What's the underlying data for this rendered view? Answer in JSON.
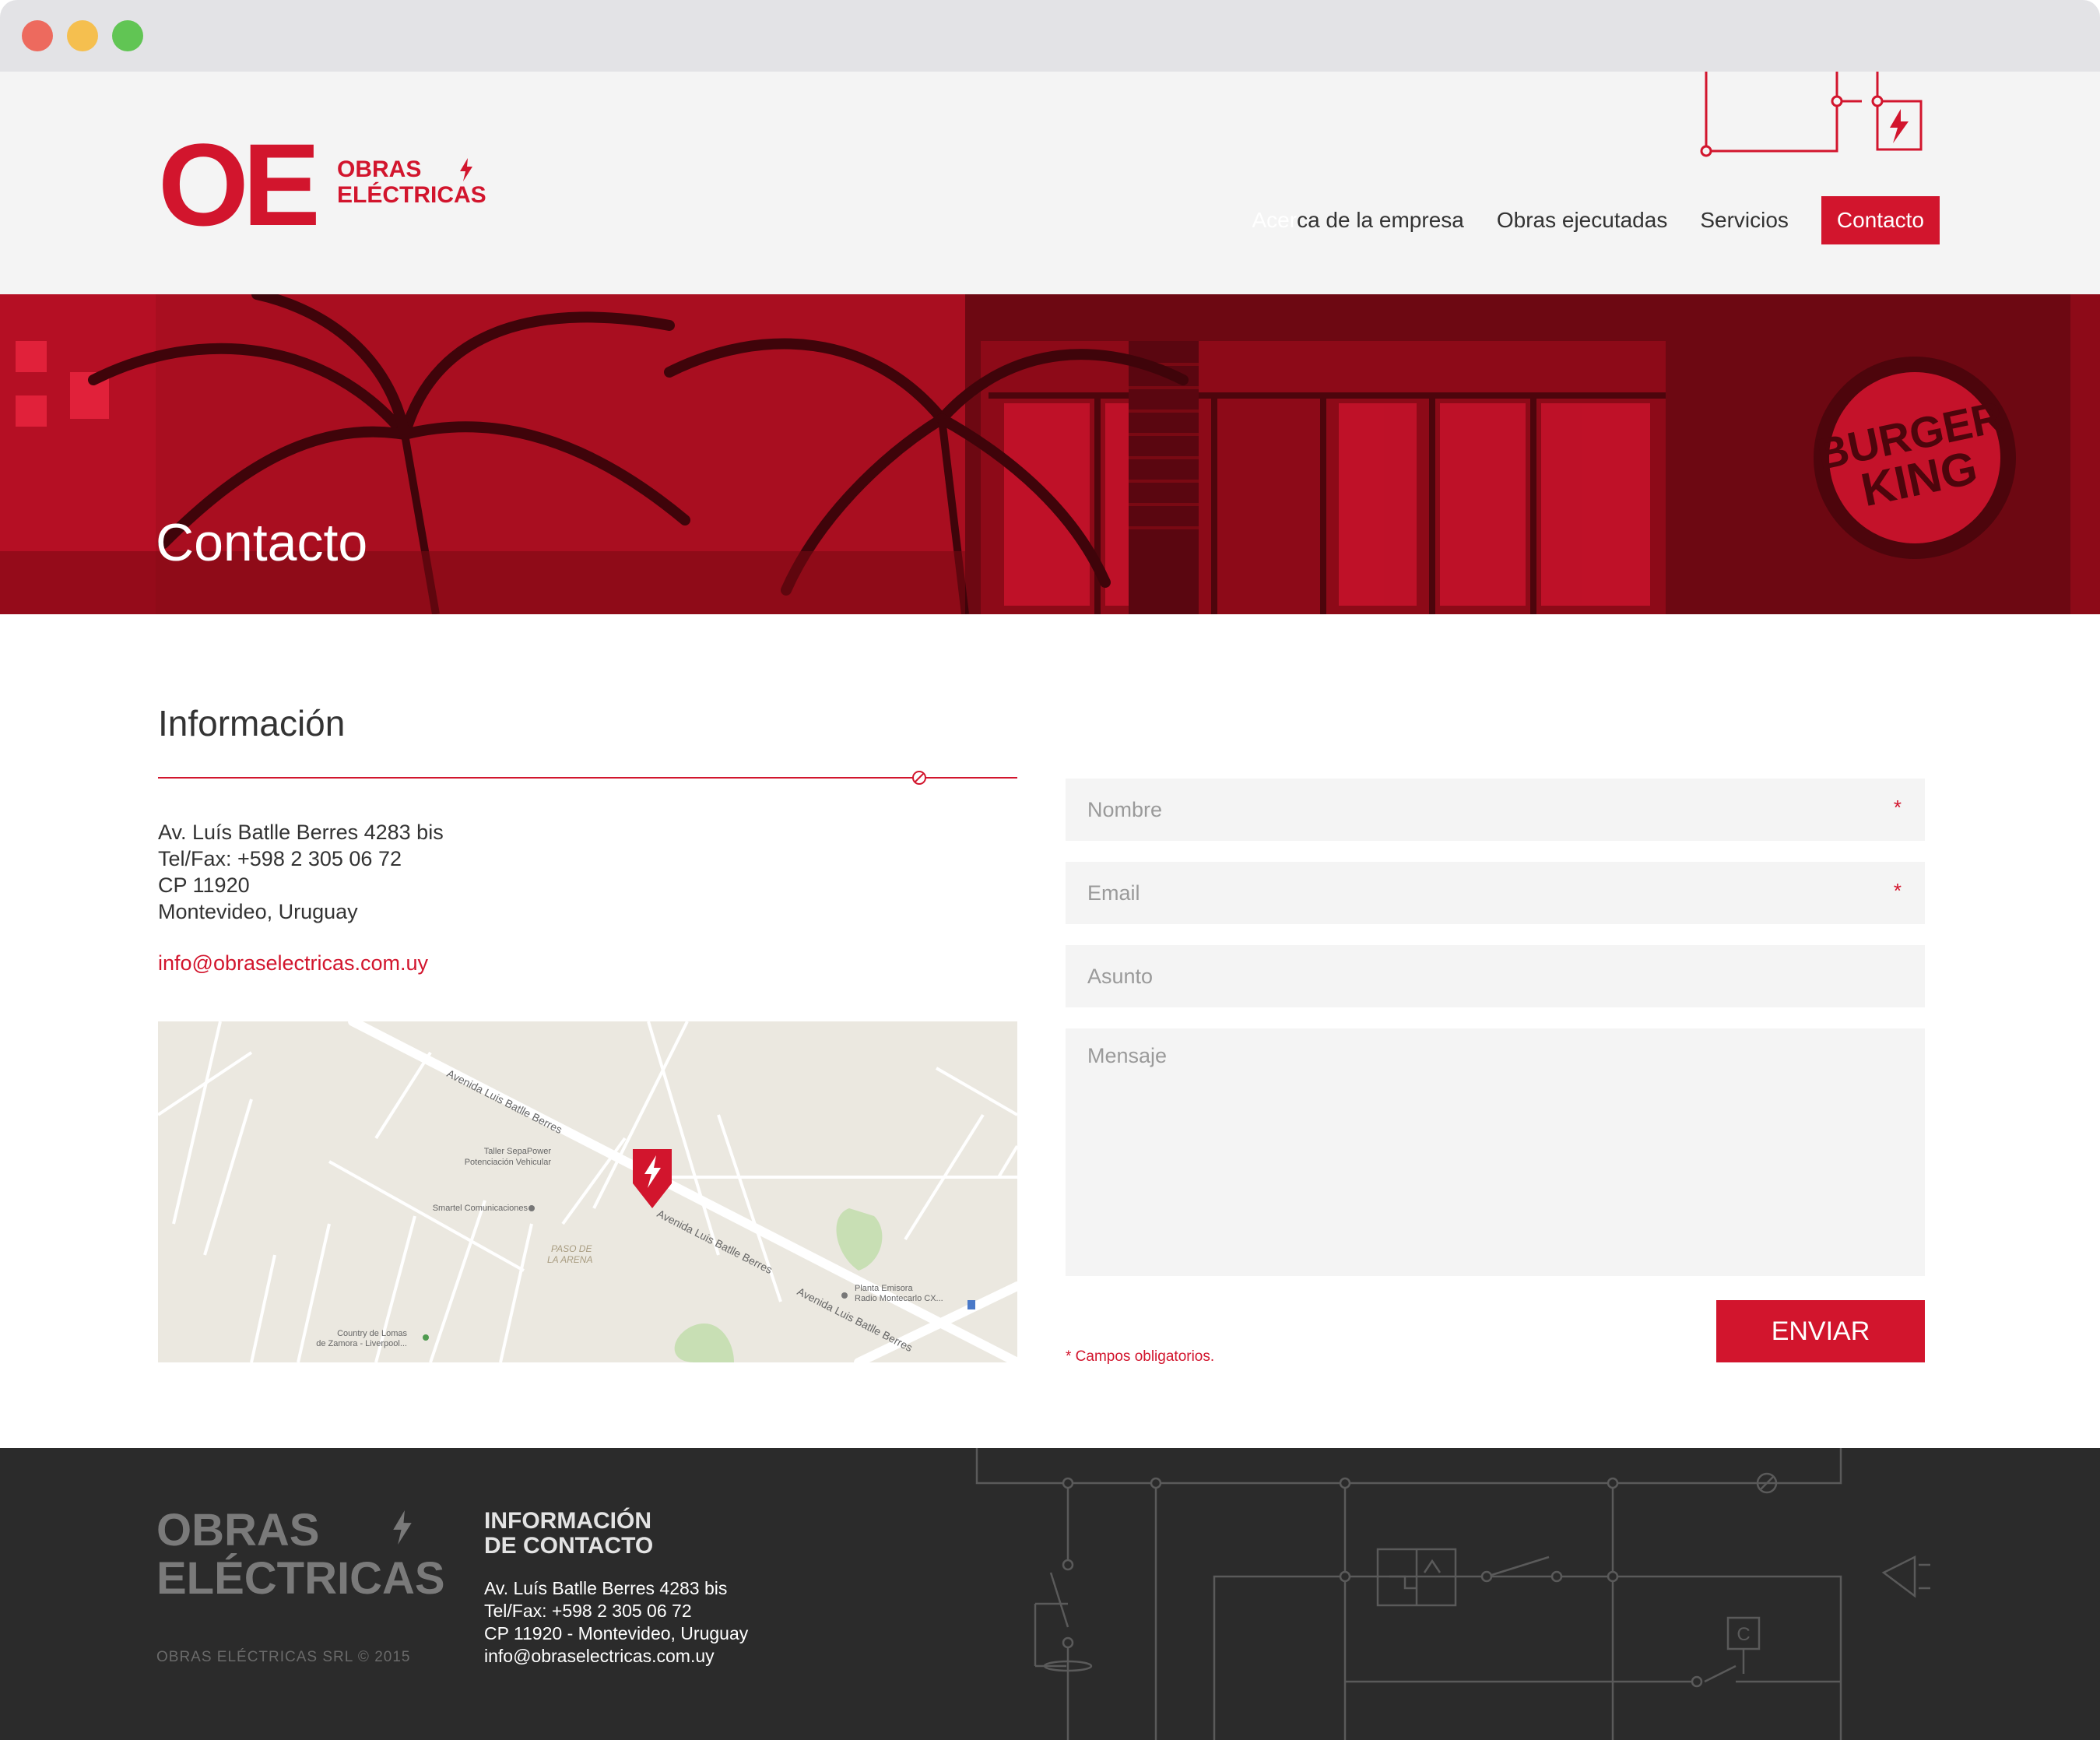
{
  "brand": {
    "mark": "OE",
    "name_line1": "OBRAS",
    "name_line2": "ELÉCTRICAS",
    "accent_color": "#d2152d"
  },
  "nav": {
    "items": [
      {
        "ghost": "Acer",
        "label": "ca de la empresa"
      },
      {
        "label": "Obras ejecutadas"
      },
      {
        "label": "Servicios"
      },
      {
        "label": "Contacto"
      }
    ]
  },
  "hero": {
    "title": "Contacto",
    "sign_line1": "BURGER",
    "sign_line2": "KING"
  },
  "info": {
    "title": "Información",
    "address_lines": [
      "Av. Luís Batlle Berres 4283 bis",
      "Tel/Fax: +598 2 305 06 72",
      "CP 11920",
      "Montevideo, Uruguay"
    ],
    "email": "info@obraselectricas.com.uy"
  },
  "map": {
    "labels": {
      "street_main_1": "Avenida Luis Batlle Berres",
      "street_main_2": "Avenida Luis Batlle Berres",
      "street_main_3": "Avenida Luis Batlle Berres",
      "poi_taller_1": "Taller SepaPower",
      "poi_taller_2": "Potenciación Vehicular",
      "poi_smartel": "Smartel Comunicaciones",
      "area_1": "PASO DE",
      "area_2": "LA ARENA",
      "poi_planta_1": "Planta Emisora",
      "poi_planta_2": "Radio Montecarlo CX...",
      "poi_country_1": "Country de Lomas",
      "poi_country_2": "de Zamora - Liverpool..."
    }
  },
  "form": {
    "name_placeholder": "Nombre",
    "email_placeholder": "Email",
    "subject_placeholder": "Asunto",
    "message_placeholder": "Mensaje",
    "required_mark": "*",
    "required_note": "* Campos obligatorios.",
    "submit_label": "ENVIAR"
  },
  "footer": {
    "logo_line1": "OBRAS",
    "logo_line2": "ELÉCTRICAS",
    "copyright": "OBRAS ELÉCTRICAS SRL © 2015",
    "heading_line1": "INFORMACIÓN",
    "heading_line2": "DE CONTACTO",
    "info_lines": [
      "Av. Luís Batlle Berres 4283 bis",
      "Tel/Fax: +598 2 305 06 72",
      "CP 11920 - Montevideo, Uruguay",
      "info@obraselectricas.com.uy"
    ],
    "circuit_label": "C"
  }
}
